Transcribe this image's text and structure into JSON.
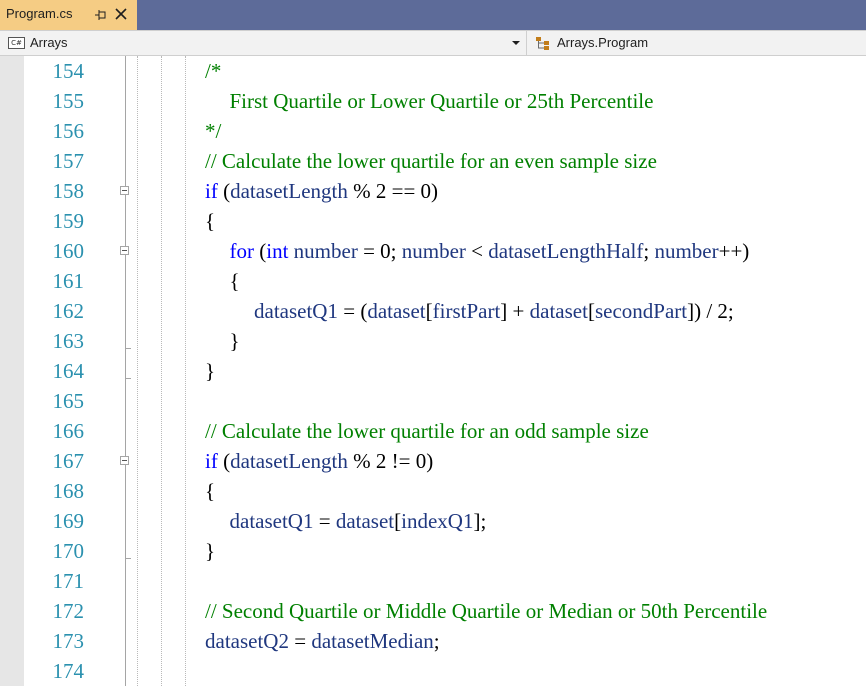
{
  "tab": {
    "title": "Program.cs",
    "pin_glyph": "pin-icon",
    "close_glyph": "close-icon"
  },
  "navbar": {
    "project_icon": "C#",
    "project": "Arrays",
    "member": "Arrays.Program"
  },
  "colors": {
    "tab_bg": "#f5cc84",
    "tabstrip_bg": "#5d6b99",
    "line_number": "#2b91af",
    "comment": "#008000",
    "keyword": "#0000ff",
    "identifier": "#1f377f"
  },
  "lines": [
    {
      "num": "154",
      "indent": 0,
      "fold": false,
      "fold_end": false,
      "tokens": [
        [
          "c",
          "/*"
        ]
      ]
    },
    {
      "num": "155",
      "indent": 1,
      "fold": false,
      "fold_end": false,
      "tokens": [
        [
          "c",
          "First Quartile or Lower Quartile or 25th Percentile"
        ]
      ]
    },
    {
      "num": "156",
      "indent": 0,
      "fold": false,
      "fold_end": false,
      "tokens": [
        [
          "c",
          "*/"
        ]
      ]
    },
    {
      "num": "157",
      "indent": 0,
      "fold": false,
      "fold_end": false,
      "tokens": [
        [
          "c",
          "// Calculate the lower quartile for an even sample size"
        ]
      ]
    },
    {
      "num": "158",
      "indent": 0,
      "fold": true,
      "fold_end": false,
      "tokens": [
        [
          "k",
          "if"
        ],
        [
          "p",
          " ("
        ],
        [
          "i",
          "datasetLength"
        ],
        [
          "p",
          " % 2 == 0)"
        ]
      ]
    },
    {
      "num": "159",
      "indent": 0,
      "fold": false,
      "fold_end": false,
      "tokens": [
        [
          "p",
          "{"
        ]
      ]
    },
    {
      "num": "160",
      "indent": 1,
      "fold": true,
      "fold_end": false,
      "tokens": [
        [
          "k",
          "for"
        ],
        [
          "p",
          " ("
        ],
        [
          "k",
          "int"
        ],
        [
          "p",
          " "
        ],
        [
          "i",
          "number"
        ],
        [
          "p",
          " = 0; "
        ],
        [
          "i",
          "number"
        ],
        [
          "p",
          " < "
        ],
        [
          "i",
          "datasetLengthHalf"
        ],
        [
          "p",
          "; "
        ],
        [
          "i",
          "number"
        ],
        [
          "p",
          "++)"
        ]
      ]
    },
    {
      "num": "161",
      "indent": 1,
      "fold": false,
      "fold_end": false,
      "tokens": [
        [
          "p",
          "{"
        ]
      ]
    },
    {
      "num": "162",
      "indent": 2,
      "fold": false,
      "fold_end": false,
      "tokens": [
        [
          "i",
          "datasetQ1"
        ],
        [
          "p",
          " = ("
        ],
        [
          "i",
          "dataset"
        ],
        [
          "p",
          "["
        ],
        [
          "i",
          "firstPart"
        ],
        [
          "p",
          "] + "
        ],
        [
          "i",
          "dataset"
        ],
        [
          "p",
          "["
        ],
        [
          "i",
          "secondPart"
        ],
        [
          "p",
          "]) / 2;"
        ]
      ]
    },
    {
      "num": "163",
      "indent": 1,
      "fold": false,
      "fold_end": true,
      "tokens": [
        [
          "p",
          "}"
        ]
      ]
    },
    {
      "num": "164",
      "indent": 0,
      "fold": false,
      "fold_end": true,
      "tokens": [
        [
          "p",
          "}"
        ]
      ]
    },
    {
      "num": "165",
      "indent": 0,
      "fold": false,
      "fold_end": false,
      "tokens": []
    },
    {
      "num": "166",
      "indent": 0,
      "fold": false,
      "fold_end": false,
      "tokens": [
        [
          "c",
          "// Calculate the lower quartile for an odd sample size"
        ]
      ]
    },
    {
      "num": "167",
      "indent": 0,
      "fold": true,
      "fold_end": false,
      "tokens": [
        [
          "k",
          "if"
        ],
        [
          "p",
          " ("
        ],
        [
          "i",
          "datasetLength"
        ],
        [
          "p",
          " % 2 != 0)"
        ]
      ]
    },
    {
      "num": "168",
      "indent": 0,
      "fold": false,
      "fold_end": false,
      "tokens": [
        [
          "p",
          "{"
        ]
      ]
    },
    {
      "num": "169",
      "indent": 1,
      "fold": false,
      "fold_end": false,
      "tokens": [
        [
          "i",
          "datasetQ1"
        ],
        [
          "p",
          " = "
        ],
        [
          "i",
          "dataset"
        ],
        [
          "p",
          "["
        ],
        [
          "i",
          "indexQ1"
        ],
        [
          "p",
          "];"
        ]
      ]
    },
    {
      "num": "170",
      "indent": 0,
      "fold": false,
      "fold_end": true,
      "tokens": [
        [
          "p",
          "}"
        ]
      ]
    },
    {
      "num": "171",
      "indent": 0,
      "fold": false,
      "fold_end": false,
      "tokens": []
    },
    {
      "num": "172",
      "indent": 0,
      "fold": false,
      "fold_end": false,
      "tokens": [
        [
          "c",
          "// Second Quartile or Middle Quartile or Median or 50th Percentile"
        ]
      ]
    },
    {
      "num": "173",
      "indent": 0,
      "fold": false,
      "fold_end": false,
      "tokens": [
        [
          "i",
          "datasetQ2"
        ],
        [
          "p",
          " = "
        ],
        [
          "i",
          "datasetMedian"
        ],
        [
          "p",
          ";"
        ]
      ]
    },
    {
      "num": "174",
      "indent": 0,
      "fold": false,
      "fold_end": false,
      "tokens": []
    }
  ]
}
